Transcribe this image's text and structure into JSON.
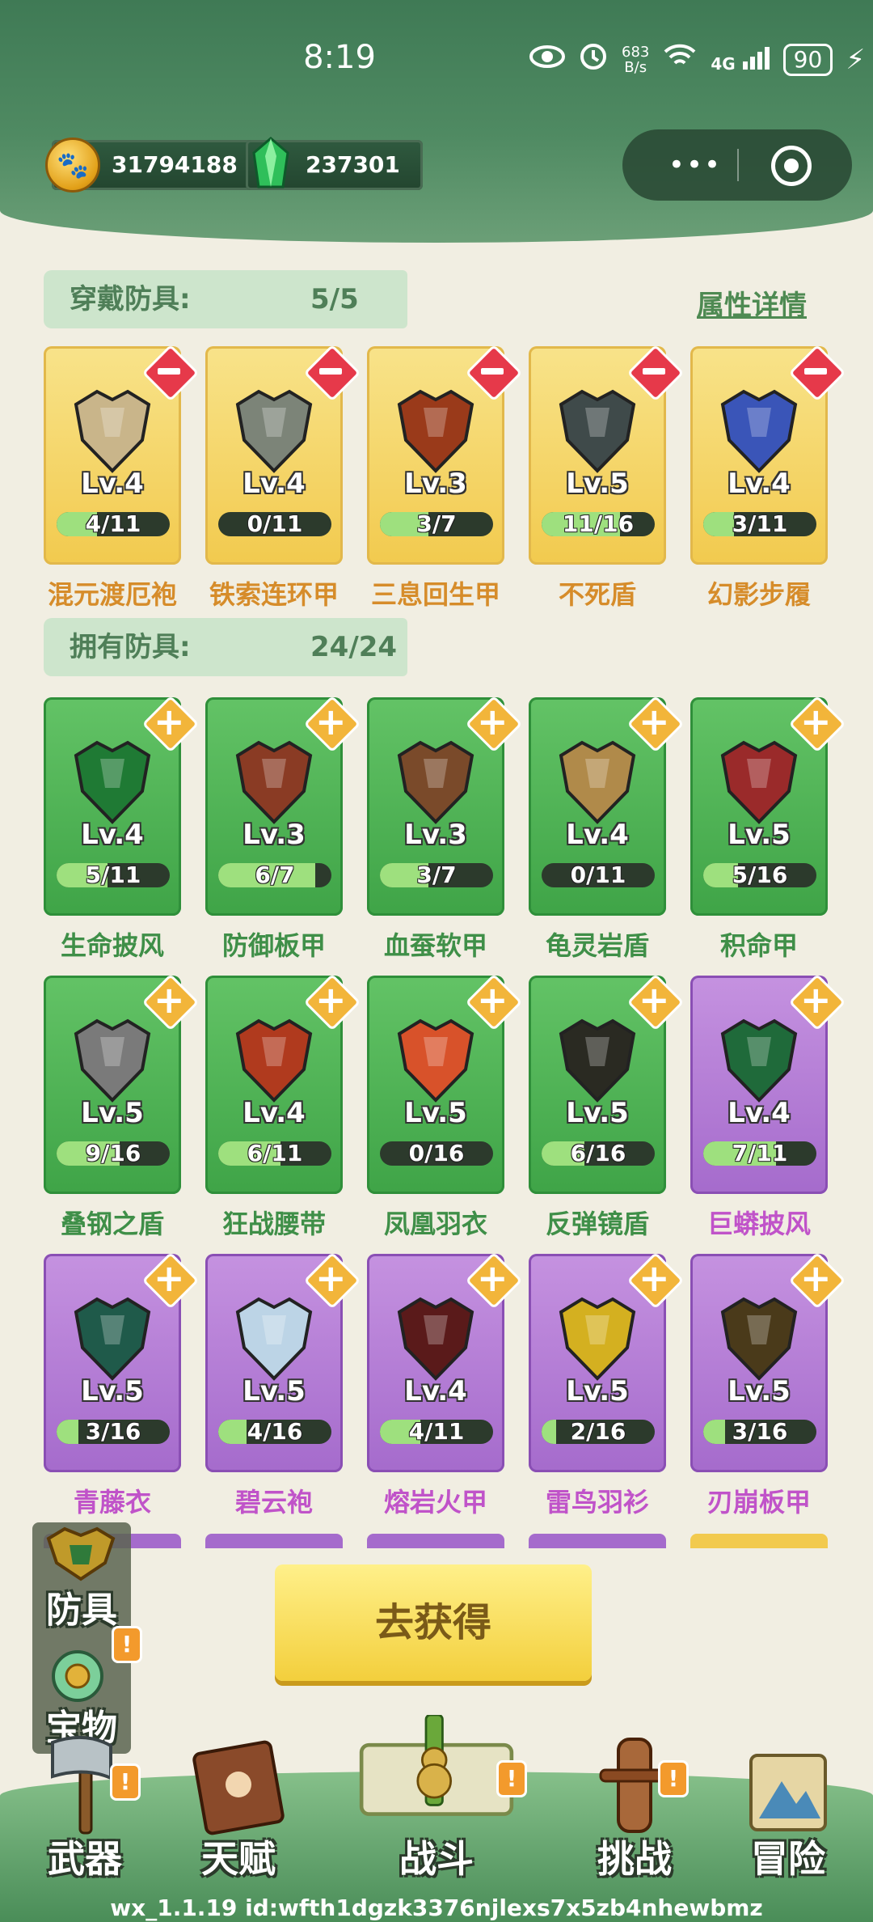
{
  "status_bar": {
    "time": "8:19",
    "net_speed_value": "683",
    "net_speed_unit": "B/s",
    "signal": "4G",
    "battery": "90"
  },
  "currency": [
    {
      "icon": "paw-coin-icon",
      "value": "31794188"
    },
    {
      "icon": "green-crystal-icon",
      "value": "237301"
    }
  ],
  "equipped": {
    "label": "穿戴防具:",
    "count": "5/5",
    "detail_link": "属性详情",
    "items": [
      {
        "name": "混元渡厄袍",
        "level": "Lv.4",
        "progress": "4/11",
        "fraction": 0.36,
        "rarity": "gold",
        "icon": "robe-icon",
        "color": "#c9b58a"
      },
      {
        "name": "铁索连环甲",
        "level": "Lv.4",
        "progress": "0/11",
        "fraction": 0.0,
        "rarity": "gold",
        "icon": "chain-armor-icon",
        "color": "#7c8478"
      },
      {
        "name": "三息回生甲",
        "level": "Lv.3",
        "progress": "3/7",
        "fraction": 0.43,
        "rarity": "gold",
        "icon": "fire-armor-icon",
        "color": "#9a3a1a"
      },
      {
        "name": "不死盾",
        "level": "Lv.5",
        "progress": "11/16",
        "fraction": 0.69,
        "rarity": "gold",
        "icon": "skull-shield-icon",
        "color": "#3f4a4a"
      },
      {
        "name": "幻影步履",
        "level": "Lv.4",
        "progress": "3/11",
        "fraction": 0.27,
        "rarity": "gold",
        "icon": "boots-icon",
        "color": "#3a55b8"
      }
    ]
  },
  "owned": {
    "label": "拥有防具:",
    "count": "24/24",
    "rows": [
      [
        {
          "name": "生命披风",
          "level": "Lv.4",
          "progress": "5/11",
          "fraction": 0.45,
          "rarity": "green",
          "icon": "cloak-icon",
          "color": "#1f7a34"
        },
        {
          "name": "防御板甲",
          "level": "Lv.3",
          "progress": "6/7",
          "fraction": 0.86,
          "rarity": "green",
          "icon": "plate-armor-icon",
          "color": "#8a3b24"
        },
        {
          "name": "血蚕软甲",
          "level": "Lv.3",
          "progress": "3/7",
          "fraction": 0.43,
          "rarity": "green",
          "icon": "leather-armor-icon",
          "color": "#7a4a2a"
        },
        {
          "name": "龟灵岩盾",
          "level": "Lv.4",
          "progress": "0/11",
          "fraction": 0.0,
          "rarity": "green",
          "icon": "rock-shield-icon",
          "color": "#b08a4a"
        },
        {
          "name": "积命甲",
          "level": "Lv.5",
          "progress": "5/16",
          "fraction": 0.31,
          "rarity": "green",
          "icon": "red-armor-icon",
          "color": "#9a2a2a"
        }
      ],
      [
        {
          "name": "叠钢之盾",
          "level": "Lv.5",
          "progress": "9/16",
          "fraction": 0.56,
          "rarity": "green",
          "icon": "steel-shield-icon",
          "color": "#7a7a7a"
        },
        {
          "name": "狂战腰带",
          "level": "Lv.4",
          "progress": "6/11",
          "fraction": 0.55,
          "rarity": "green",
          "icon": "belt-icon",
          "color": "#b03a1e"
        },
        {
          "name": "凤凰羽衣",
          "level": "Lv.5",
          "progress": "0/16",
          "fraction": 0.0,
          "rarity": "green",
          "icon": "phoenix-robe-icon",
          "color": "#d8522a"
        },
        {
          "name": "反弹镜盾",
          "level": "Lv.5",
          "progress": "6/16",
          "fraction": 0.38,
          "rarity": "green",
          "icon": "round-shield-icon",
          "color": "#2a2a22"
        },
        {
          "name": "巨蟒披风",
          "level": "Lv.4",
          "progress": "7/11",
          "fraction": 0.64,
          "rarity": "purple",
          "icon": "serpent-cloak-icon",
          "color": "#1f6a3a"
        }
      ],
      [
        {
          "name": "青藤衣",
          "level": "Lv.5",
          "progress": "3/16",
          "fraction": 0.19,
          "rarity": "purple",
          "icon": "vine-armor-icon",
          "color": "#1f5a4a"
        },
        {
          "name": "碧云袍",
          "level": "Lv.5",
          "progress": "4/16",
          "fraction": 0.25,
          "rarity": "purple",
          "icon": "cloud-robe-icon",
          "color": "#bcd4e6"
        },
        {
          "name": "熔岩火甲",
          "level": "Lv.4",
          "progress": "4/11",
          "fraction": 0.36,
          "rarity": "purple",
          "icon": "lava-armor-icon",
          "color": "#5a1a1a"
        },
        {
          "name": "雷鸟羽衫",
          "level": "Lv.5",
          "progress": "2/16",
          "fraction": 0.13,
          "rarity": "purple",
          "icon": "thunder-armor-icon",
          "color": "#d4b020"
        },
        {
          "name": "刃崩板甲",
          "level": "Lv.5",
          "progress": "3/16",
          "fraction": 0.19,
          "rarity": "purple",
          "icon": "gold-plate-icon",
          "color": "#4a3a1a"
        }
      ]
    ]
  },
  "get_button": "去获得",
  "side_tabs": [
    {
      "label": "防具",
      "icon": "armor-tab-icon"
    },
    {
      "label": "宝物",
      "icon": "treasure-tab-icon",
      "alert": "!"
    }
  ],
  "nav": [
    {
      "label": "武器",
      "icon": "axe-icon",
      "alert": "!"
    },
    {
      "label": "天赋",
      "icon": "talent-book-icon"
    },
    {
      "label": "战斗",
      "icon": "gourd-scroll-icon",
      "alert": "!"
    },
    {
      "label": "挑战",
      "icon": "wooden-dummy-icon",
      "alert": "!"
    },
    {
      "label": "冒险",
      "icon": "adventure-map-icon"
    }
  ],
  "version_text": "wx_1.1.19 id:wfth1dgzk3376njlexs7x5zb4nhewbmz"
}
